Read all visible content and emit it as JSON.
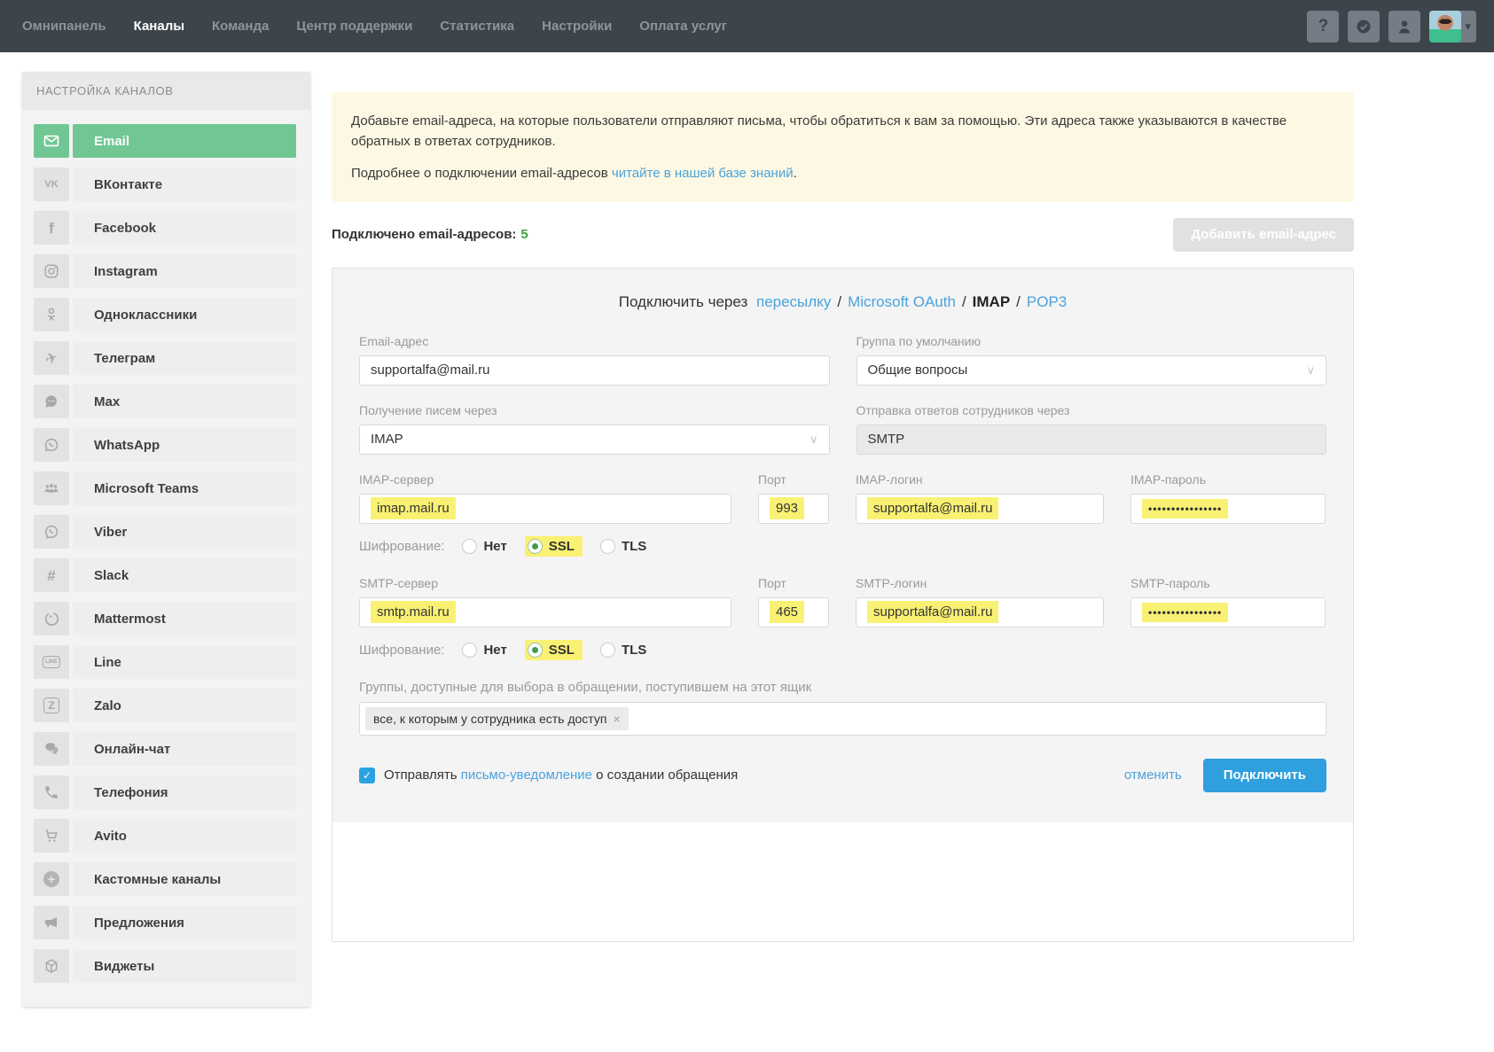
{
  "nav": {
    "items": [
      {
        "label": "Омнипанель",
        "active": false
      },
      {
        "label": "Каналы",
        "active": true
      },
      {
        "label": "Команда",
        "active": false
      },
      {
        "label": "Центр поддержки",
        "active": false
      },
      {
        "label": "Статистика",
        "active": false
      },
      {
        "label": "Настройки",
        "active": false
      },
      {
        "label": "Оплата услуг",
        "active": false
      }
    ]
  },
  "icons": {
    "question": "?",
    "caret_down": "▾",
    "chevron_down": "∨",
    "check": "✓",
    "plus": "+",
    "close": "×",
    "plane": "✈",
    "hash": "#",
    "vk": "VK",
    "facebook": "f",
    "line": "LINE",
    "zalo": "Z"
  },
  "sidebar": {
    "title": "НАСТРОЙКА КАНАЛОВ",
    "items": [
      {
        "label": "Email",
        "selected": true
      },
      {
        "label": "ВКонтакте",
        "selected": false
      },
      {
        "label": "Facebook",
        "selected": false
      },
      {
        "label": "Instagram",
        "selected": false
      },
      {
        "label": "Одноклассники",
        "selected": false
      },
      {
        "label": "Телеграм",
        "selected": false
      },
      {
        "label": "Max",
        "selected": false
      },
      {
        "label": "WhatsApp",
        "selected": false
      },
      {
        "label": "Microsoft Teams",
        "selected": false
      },
      {
        "label": "Viber",
        "selected": false
      },
      {
        "label": "Slack",
        "selected": false
      },
      {
        "label": "Mattermost",
        "selected": false
      },
      {
        "label": "Line",
        "selected": false
      },
      {
        "label": "Zalo",
        "selected": false
      },
      {
        "label": "Онлайн-чат",
        "selected": false
      },
      {
        "label": "Телефония",
        "selected": false
      },
      {
        "label": "Avito",
        "selected": false
      },
      {
        "label": "Кастомные каналы",
        "selected": false
      },
      {
        "label": "Предложения",
        "selected": false
      },
      {
        "label": "Виджеты",
        "selected": false
      }
    ]
  },
  "main": {
    "info": {
      "paragraph1": "Добавьте email-адреса, на которые пользователи отправляют письма, чтобы обратиться к вам за помощью. Эти адреса также указываются в качестве обратных в ответах сотрудников.",
      "paragraph2_prefix": "Подробнее о подключении email-адресов ",
      "paragraph2_link": "читайте в нашей базе знаний",
      "paragraph2_suffix": "."
    },
    "connected_label": "Подключено email-адресов:",
    "connected_count": "5",
    "add_button": "Добавить email-адрес",
    "form": {
      "connect_prefix": "Подключить через",
      "sep": "/",
      "methods": [
        {
          "label": "пересылку",
          "active": false
        },
        {
          "label": "Microsoft OAuth",
          "active": false
        },
        {
          "label": "IMAP",
          "active": true
        },
        {
          "label": "POP3",
          "active": false
        }
      ],
      "email": {
        "label": "Email-адрес",
        "value": "supportalfa@mail.ru"
      },
      "group": {
        "label": "Группа по умолчанию",
        "value": "Общие вопросы"
      },
      "receive": {
        "label": "Получение писем через",
        "value": "IMAP"
      },
      "send": {
        "label": "Отправка ответов сотрудников через",
        "value": "SMTP"
      },
      "imap": {
        "server_label": "IMAP-сервер",
        "server": "imap.mail.ru",
        "port_label": "Порт",
        "port": "993",
        "login_label": "IMAP-логин",
        "login": "supportalfa@mail.ru",
        "password_label": "IMAP-пароль",
        "password": "••••••••••••••••"
      },
      "smtp": {
        "server_label": "SMTP-сервер",
        "server": "smtp.mail.ru",
        "port_label": "Порт",
        "port": "465",
        "login_label": "SMTP-логин",
        "login": "supportalfa@mail.ru",
        "password_label": "SMTP-пароль",
        "password": "••••••••••••••••"
      },
      "encryption": {
        "label": "Шифрование:",
        "options": [
          "Нет",
          "SSL",
          "TLS"
        ],
        "selected": "SSL"
      },
      "groups_field": {
        "label": "Группы, доступные для выбора в обращении, поступившем на этот ящик",
        "tag": "все, к которым у сотрудника есть доступ"
      },
      "notify": {
        "prefix": "Отправлять ",
        "link": "письмо-уведомление",
        "suffix": " о создании обращения",
        "checked": true
      },
      "cancel": "отменить",
      "submit": "Подключить"
    }
  },
  "colors": {
    "nav_bg": "#3d444c",
    "accent_green": "#71c794",
    "link_blue": "#4aa3dc",
    "button_blue": "#2f9fdd",
    "highlight_yellow": "#f9f173",
    "info_bg": "#fdf8e3",
    "count_green": "#43a047"
  }
}
